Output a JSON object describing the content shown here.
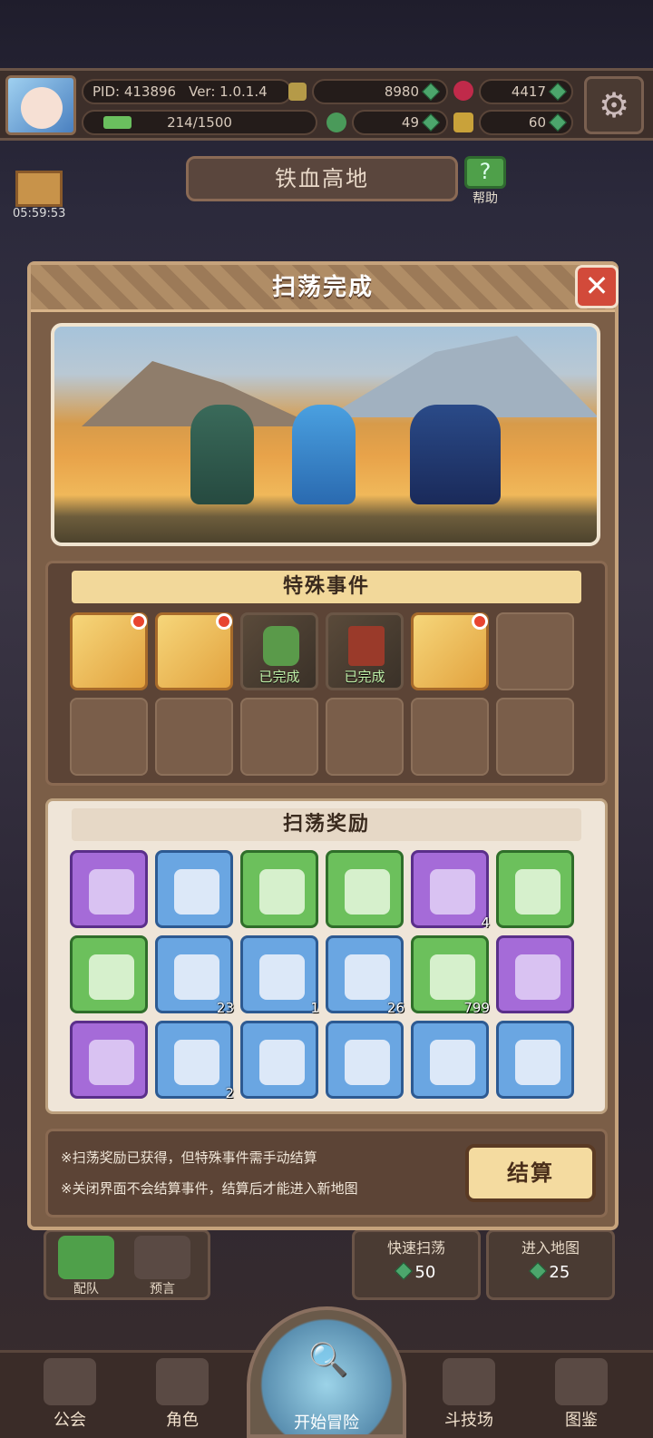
{
  "header": {
    "pid": "PID: 413896",
    "version": "Ver: 1.0.1.4",
    "gold": "8980",
    "ruby": "4417",
    "energy": "214/1500",
    "energy_fraction": 0.143,
    "clover": "49",
    "key": "60"
  },
  "map": {
    "name": "铁血高地",
    "help": "帮助"
  },
  "gift": {
    "timer": "05:59:53"
  },
  "dialog": {
    "title": "扫荡完成",
    "close": "✕",
    "events_title": "特殊事件",
    "events": [
      {
        "type": "chest",
        "new": true
      },
      {
        "type": "chest",
        "new": true
      },
      {
        "type": "goblin",
        "status": "已完成"
      },
      {
        "type": "gift",
        "status": "已完成"
      },
      {
        "type": "chest",
        "new": true
      }
    ],
    "rewards_title": "扫荡奖励",
    "rewards": [
      {
        "rarity": "purple",
        "icon": "green-gem-frame-icon",
        "count": ""
      },
      {
        "rarity": "blue",
        "icon": "crystal-icon",
        "count": ""
      },
      {
        "rarity": "green",
        "icon": "purple-crystal-icon",
        "count": ""
      },
      {
        "rarity": "green",
        "icon": "crystal-icon",
        "count": ""
      },
      {
        "rarity": "purple",
        "icon": "fruit-icon",
        "count": "4"
      },
      {
        "rarity": "green",
        "icon": "slime-pink-icon",
        "count": ""
      },
      {
        "rarity": "green",
        "icon": "slime-green-icon",
        "count": ""
      },
      {
        "rarity": "blue",
        "icon": "meat-icon",
        "count": "23"
      },
      {
        "rarity": "blue",
        "icon": "potion-jar-icon",
        "count": "1"
      },
      {
        "rarity": "blue",
        "icon": "log-icon",
        "count": "26"
      },
      {
        "rarity": "green",
        "icon": "white-gem-icon",
        "count": "799"
      },
      {
        "rarity": "purple",
        "icon": "ring-icon",
        "count": ""
      },
      {
        "rarity": "purple",
        "icon": "dark-armor-icon",
        "count": ""
      },
      {
        "rarity": "blue",
        "icon": "helmet-icon",
        "count": "2"
      },
      {
        "rarity": "blue",
        "icon": "leather-armor-icon",
        "count": ""
      },
      {
        "rarity": "blue",
        "icon": "bone-icon",
        "count": ""
      },
      {
        "rarity": "blue",
        "icon": "chest-armor-icon",
        "count": ""
      },
      {
        "rarity": "blue",
        "icon": "boots-icon",
        "count": ""
      }
    ],
    "note1": "※扫荡奖励已获得，但特殊事件需手动结算",
    "note2": "※关闭界面不会结算事件，结算后才能进入新地图",
    "settle": "结算"
  },
  "under": {
    "team": "配队",
    "prophecy": "预言",
    "quick_sweep": "快速扫荡",
    "quick_cost": "50",
    "enter_map": "进入地图",
    "enter_cost": "25"
  },
  "nav": [
    "公会",
    "角色",
    "开始冒险",
    "斗技场",
    "图鉴"
  ]
}
